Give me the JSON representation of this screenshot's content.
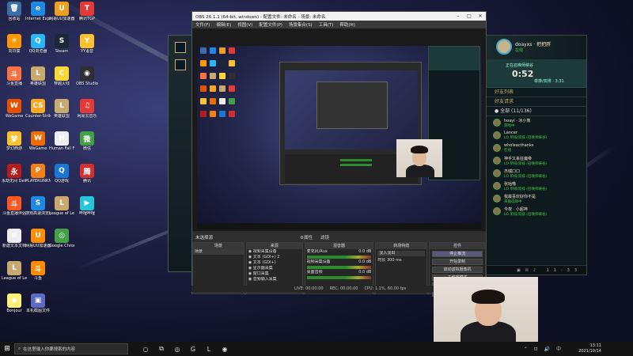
{
  "desktop_icons": [
    {
      "label": "回收站",
      "glyph": "🗑",
      "color": "#3a6ea5"
    },
    {
      "label": "Internet Explorer",
      "glyph": "e",
      "color": "#1e88e5"
    },
    {
      "label": "网易UU加速器",
      "glyph": "U",
      "color": "#f0a020"
    },
    {
      "label": "腾讯TGP",
      "glyph": "T",
      "color": "#e53935"
    },
    {
      "label": "向日葵",
      "glyph": "☀",
      "color": "#ff9800"
    },
    {
      "label": "QQ浏览器",
      "glyph": "Q",
      "color": "#29b6f6"
    },
    {
      "label": "Steam",
      "glyph": "S",
      "color": "#1b2838"
    },
    {
      "label": "YY语音",
      "glyph": "Y",
      "color": "#fbc02d"
    },
    {
      "label": "斗鱼直播",
      "glyph": "斗",
      "color": "#ff7043"
    },
    {
      "label": "英雄联盟",
      "glyph": "L",
      "color": "#c8aa6e"
    },
    {
      "label": "穿越火线",
      "glyph": "C",
      "color": "#fdd835"
    },
    {
      "label": "OBS Studio",
      "glyph": "◉",
      "color": "#302e31"
    },
    {
      "label": "WeGame",
      "glyph": "W",
      "color": "#e65100"
    },
    {
      "label": "Counter-Strike Global Off",
      "glyph": "CS",
      "color": "#f9a825"
    },
    {
      "label": "英雄联盟",
      "glyph": "L",
      "color": "#c8aa6e"
    },
    {
      "label": "网易云音乐",
      "glyph": "♫",
      "color": "#e53935"
    },
    {
      "label": "梦幻西游",
      "glyph": "梦",
      "color": "#fbc02d"
    },
    {
      "label": "WeGame",
      "glyph": "W",
      "color": "#ef6c00"
    },
    {
      "label": "Human Fall Flat",
      "glyph": "H",
      "color": "#eeeeee"
    },
    {
      "label": "微信",
      "glyph": "微",
      "color": "#43a047"
    },
    {
      "label": "永劫无间 Demo",
      "glyph": "永",
      "color": "#b71c1c"
    },
    {
      "label": "PLAYERUNKNOWN BATTLEGR",
      "glyph": "P",
      "color": "#f57f17"
    },
    {
      "label": "QQ游戏",
      "glyph": "Q",
      "color": "#1976d2"
    },
    {
      "label": "腾讯",
      "glyph": "腾",
      "color": "#d32f2f"
    },
    {
      "label": "斗鱼直播伴侣",
      "glyph": "斗",
      "color": "#ff5722"
    },
    {
      "label": "搜狗高速浏览器",
      "glyph": "S",
      "color": "#1e88e5"
    },
    {
      "label": "League of Legends",
      "glyph": "L",
      "color": "#c8aa6e"
    },
    {
      "label": "哔哩哔哩",
      "glyph": "▶",
      "color": "#26c6da"
    },
    {
      "label": "新建文本文档",
      "glyph": "≡",
      "color": "#eeeeee"
    },
    {
      "label": "网易UU加速器",
      "glyph": "U",
      "color": "#ff8f00"
    },
    {
      "label": "Google Chrome",
      "glyph": "◎",
      "color": "#43a047"
    },
    {
      "label": "",
      "glyph": "",
      "color": "transparent"
    },
    {
      "label": "League of Legends",
      "glyph": "L",
      "color": "#c8aa6e"
    },
    {
      "label": "斗鱼",
      "glyph": "斗",
      "color": "#fb8c00"
    },
    {
      "label": "",
      "glyph": "",
      "color": "transparent"
    },
    {
      "label": "",
      "glyph": "",
      "color": "transparent"
    },
    {
      "label": "Bonjour",
      "glyph": "◆",
      "color": "#fff176"
    },
    {
      "label": "本机截图文件",
      "glyph": "▣",
      "color": "#5c6bc0"
    }
  ],
  "obs": {
    "title": "OBS 26.1.1 (64-bit, windows) - 配置文件: 未命名 - 场景: 未命名",
    "menu": [
      "文件(F)",
      "编辑(E)",
      "视图(V)",
      "配置文件(P)",
      "场景集合(S)",
      "工具(T)",
      "帮助(H)"
    ],
    "no_source_label": "未选择源",
    "toolbar": {
      "props": "⚙属性",
      "filters": "滤镜"
    },
    "docks": {
      "scenes": {
        "title": "场景",
        "items": [
          "场景"
        ]
      },
      "sources": {
        "title": "来源",
        "items": [
          "视频采集设备",
          "文本 (GDI+) 2",
          "文本 (GDI+)",
          "显示器采集",
          "窗口采集",
          "音频输入采集"
        ]
      },
      "mixer": {
        "title": "混音器",
        "channels": [
          {
            "name": "麦克风/Aux",
            "db": "0.0 dB"
          },
          {
            "name": "视频采集设备",
            "db": "0.0 dB"
          },
          {
            "name": "桌面音频",
            "db": "0.0 dB"
          }
        ]
      },
      "transitions": {
        "title": "转场特效",
        "type": "淡入淡出",
        "duration_label": "时长",
        "duration": "300 ms"
      },
      "controls": {
        "title": "控件",
        "buttons": [
          "停止推流",
          "开始录制",
          "启动虚拟摄像机",
          "工作室模式",
          "设置",
          "退出"
        ]
      }
    },
    "status": {
      "live": "LIVE: 00:00:00",
      "rec": "REC: 00:00:00",
      "cpu": "CPU: 1.1%, 60.00 fps"
    }
  },
  "lol": {
    "top_numbers": [
      "150",
      "9001"
    ],
    "summoner_name": "doayxs · 把把胖",
    "summoner_status": "在线",
    "game_label": "正在召唤师峡谷",
    "game_timer": "0:52",
    "game_sub": "单排/双排 · 3:31",
    "friends_header": "好友列表",
    "requests_header": "好友请求",
    "group_header": "● 全部 (11/136)",
    "friends": [
      {
        "name": "hoayi · 冰小熊",
        "status": "游戏中"
      },
      {
        "name": "Lancer",
        "status": "LO 单排/双排 (召唤师峡谷)"
      },
      {
        "name": "wholeacthanks",
        "status": "在线"
      },
      {
        "name": "神手又来狂魔帝",
        "status": "LO 单排/双排 (召唤师峡谷)"
      },
      {
        "name": "杰瑞口口",
        "status": "LO 单排/双排 (召唤师峡谷)"
      },
      {
        "name": "张咕噜",
        "status": "LO 单排/双排 (召唤师峡谷)"
      },
      {
        "name": "我最喜欢好你不是",
        "status": "英雄选择中"
      },
      {
        "name": "今夜 · 小超神",
        "status": "LO 单排/双排 (召唤师峡谷)"
      }
    ],
    "footer_time": "11:33"
  },
  "taskbar": {
    "start_glyph": "⊞",
    "search_placeholder": "在这里输入你要搜索的内容",
    "apps": [
      "○",
      "⧉",
      "◎",
      "G",
      "L",
      "◉"
    ],
    "tray_icons": "⌃ ⊡ 🔊 中",
    "time": "13:11",
    "date": "2021/10/14"
  }
}
